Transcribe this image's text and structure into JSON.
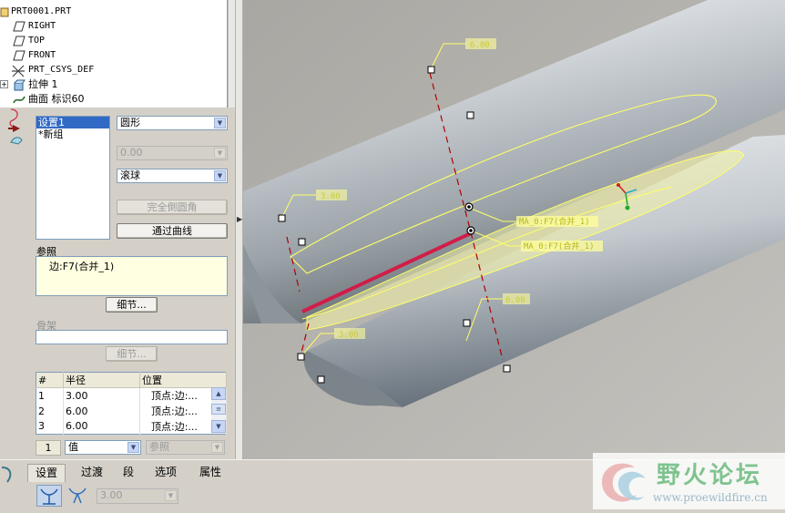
{
  "tree": {
    "items": [
      {
        "label": "PRT0001.PRT",
        "icon": "part-icon"
      },
      {
        "label": "RIGHT",
        "icon": "datum-plane-icon"
      },
      {
        "label": "TOP",
        "icon": "datum-plane-icon"
      },
      {
        "label": "FRONT",
        "icon": "datum-plane-icon"
      },
      {
        "label": "PRT_CSYS_DEF",
        "icon": "csys-icon"
      },
      {
        "label": "拉伸 1",
        "icon": "extrude-icon"
      },
      {
        "label": "曲面 标识60",
        "icon": "surface-icon"
      }
    ]
  },
  "sets": {
    "items": [
      "设置1",
      "*新组"
    ],
    "selected": 0
  },
  "shape": {
    "value": "圆形"
  },
  "value_disabled": {
    "value": "0.00"
  },
  "method": {
    "value": "滚球"
  },
  "buttons": {
    "full_round": "完全倒圆角",
    "through_curve": "通过曲线",
    "details_ref": "细节...",
    "details_spine": "细节..."
  },
  "references": {
    "label": "参照",
    "value": "边:F7(合并_1)"
  },
  "spine": {
    "label": "骨架"
  },
  "radius_table": {
    "headers": [
      "#",
      "半径",
      "位置"
    ],
    "rows": [
      {
        "index": "1",
        "radius": "3.00",
        "location": "顶点:边:..."
      },
      {
        "index": "2",
        "radius": "6.00",
        "location": "顶点:边:..."
      },
      {
        "index": "3",
        "radius": "6.00",
        "location": "顶点:边:..."
      }
    ]
  },
  "radius_controls": {
    "count": "1",
    "mode": "值",
    "ref": "参照"
  },
  "viewport": {
    "dims": [
      "6.00",
      "3.00",
      "6.00",
      "3.00"
    ],
    "tags": [
      "MA_0:F7(合并_1)",
      "MA_0:F7(合并_1)"
    ],
    "colors": {
      "background": "#b3b1ac",
      "model_light": "#d9dde1",
      "model_dark": "#6b7379",
      "edge": "#ffff66",
      "selected_edge": "#d11d48",
      "dim_line": "#b00000"
    }
  },
  "bottom": {
    "tabs": [
      "设置",
      "过渡",
      "段",
      "选项",
      "属性"
    ],
    "active_tab": 0,
    "value": "3.00"
  },
  "watermark": {
    "text": "野火论坛",
    "url": "www.proewildfire.cn"
  }
}
